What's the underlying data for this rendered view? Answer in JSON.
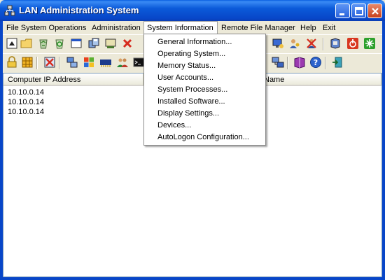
{
  "window": {
    "title": "LAN Administration System"
  },
  "menu": {
    "items": [
      "File System Operations",
      "Administration",
      "System Information",
      "Remote File Manager",
      "Help",
      "Exit"
    ],
    "active": "System Information"
  },
  "dropdown": {
    "items": [
      "General Information...",
      "Operating System...",
      "Memory Status...",
      "User Accounts...",
      "System Processes...",
      "Installed Software...",
      "Display Settings...",
      "Devices...",
      "AutoLogon Configuration..."
    ]
  },
  "list": {
    "columns": [
      "Computer IP Address",
      "Name"
    ],
    "rows": [
      "10.10.0.14",
      "10.10.0.14",
      "10.10.0.14"
    ]
  },
  "icons": {
    "toolbar1": [
      "open-screen-icon",
      "folder-icon",
      "recycle-icon",
      "recycle-green-icon",
      "window-icon",
      "copy-disk-icon",
      "network-card-icon",
      "delete-x-icon",
      "monitor-user-icon",
      "users-key-icon",
      "disable-user-icon",
      "disk-drive-icon",
      "shutdown-icon",
      "refresh-icon"
    ],
    "toolbar2": [
      "lock-icon",
      "grid-icon",
      "close-program-icon",
      "network-icon",
      "windows-logo-icon",
      "memory-chip-icon",
      "users-group-icon",
      "command-prompt-icon",
      "network-connection-icon",
      "book-icon",
      "help-icon",
      "exit-door-icon"
    ]
  },
  "colors": {
    "titlebar": "#0846c8",
    "face": "#ece9d8"
  }
}
